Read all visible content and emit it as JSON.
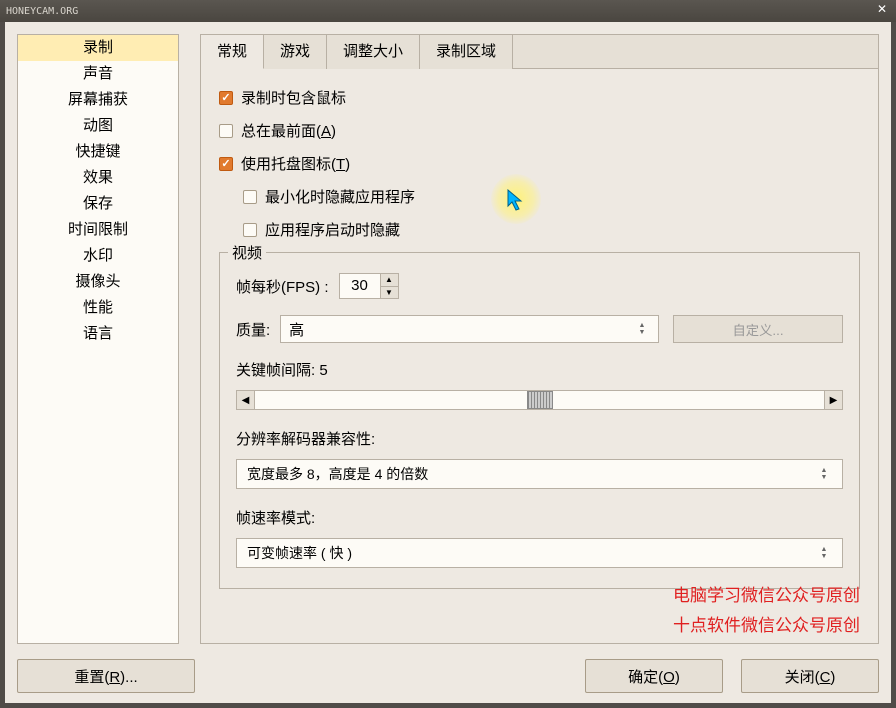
{
  "window": {
    "watermark": "HONEYCAM.ORG"
  },
  "sidebar": {
    "items": [
      "录制",
      "声音",
      "屏幕捕获",
      "动图",
      "快捷键",
      "效果",
      "保存",
      "时间限制",
      "水印",
      "摄像头",
      "性能",
      "语言"
    ]
  },
  "tabs": [
    "常规",
    "游戏",
    "调整大小",
    "录制区域"
  ],
  "general": {
    "include_cursor": "录制时包含鼠标",
    "always_top": "总在最前面(A)",
    "use_tray": "使用托盘图标(T)",
    "hide_on_min": "最小化时隐藏应用程序",
    "hide_on_start": "应用程序启动时隐藏"
  },
  "video": {
    "legend": "视频",
    "fps_label": "帧每秒(FPS) :",
    "fps_value": "30",
    "quality_label": "质量:",
    "quality_value": "高",
    "custom_btn": "自定义...",
    "keyframe_label": "关键帧间隔: 5",
    "decoder_label": "分辨率解码器兼容性:",
    "decoder_value": "宽度最多 8，高度是 4 的倍数",
    "fpsmode_label": "帧速率模式:",
    "fpsmode_value": "可变帧速率 ( 快 )"
  },
  "red_notes": {
    "line1": "电脑学习微信公众号原创",
    "line2": "十点软件微信公众号原创"
  },
  "footer": {
    "reset": "重置(R)...",
    "ok": "确定(O)",
    "close": "关闭(C)"
  }
}
